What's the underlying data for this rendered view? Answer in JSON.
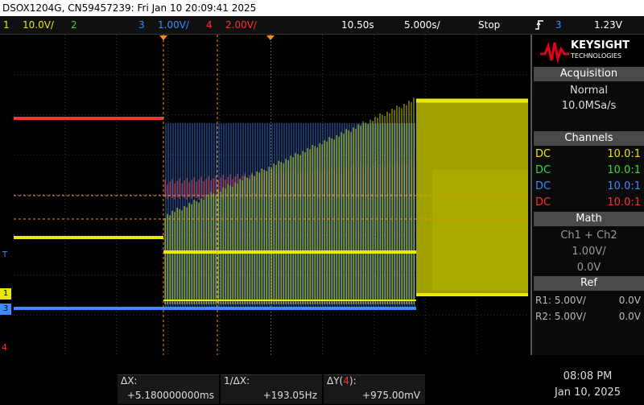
{
  "title": "DSOX1204G, CN59457239: Fri Jan 10 20:09:41 2025",
  "topbar": {
    "ch1_num": "1",
    "ch1_scale": "10.0V/",
    "ch2_num": "2",
    "ch3_num": "3",
    "ch3_scale": "1.00V/",
    "ch4_num": "4",
    "ch4_scale": "2.00V/",
    "time_pos": "10.50s",
    "time_scale": "5.000s/",
    "run_state": "Stop",
    "trigger_icon": "rising-edge-icon",
    "trigger_src": "3",
    "trigger_level": "1.23V"
  },
  "colors": {
    "ch1": "#e8e800",
    "ch2": "#33dd33",
    "ch3": "#3a8cff",
    "ch4": "#ff3030",
    "cursor": "#ff8c1a"
  },
  "brand": {
    "name": "KEYSIGHT",
    "sub": "TECHNOLOGIES"
  },
  "acquisition": {
    "header": "Acquisition",
    "mode": "Normal",
    "rate": "10.0MSa/s"
  },
  "channels": {
    "header": "Channels",
    "rows": [
      {
        "coupling": "DC",
        "probe": "10.0:1"
      },
      {
        "coupling": "DC",
        "probe": "10.0:1"
      },
      {
        "coupling": "DC",
        "probe": "10.0:1"
      },
      {
        "coupling": "DC",
        "probe": "10.0:1"
      }
    ]
  },
  "math": {
    "header": "Math",
    "function": "Ch1 + Ch2",
    "scale": "1.00V/",
    "offset": "0.0V"
  },
  "ref": {
    "header": "Ref",
    "rows": [
      {
        "name": "R1:",
        "scale": "5.00V/",
        "offset": "0.0V"
      },
      {
        "name": "R2:",
        "scale": "5.00V/",
        "offset": "0.0V"
      }
    ]
  },
  "markers": {
    "ground1": "1",
    "ground3": "3",
    "ground4": "4",
    "trigger_mark": "T"
  },
  "measurements": {
    "dx_label": "ΔX:",
    "dx_value": "+5.180000000ms",
    "inv_dx_label": "1/ΔX:",
    "inv_dx_value": "+193.05Hz",
    "dy_label": "ΔY(",
    "dy_ch": "4",
    "dy_label_end": "):",
    "dy_value": "+975.00mV"
  },
  "clock": {
    "time": "08:08 PM",
    "date": "Jan 10, 2025"
  }
}
